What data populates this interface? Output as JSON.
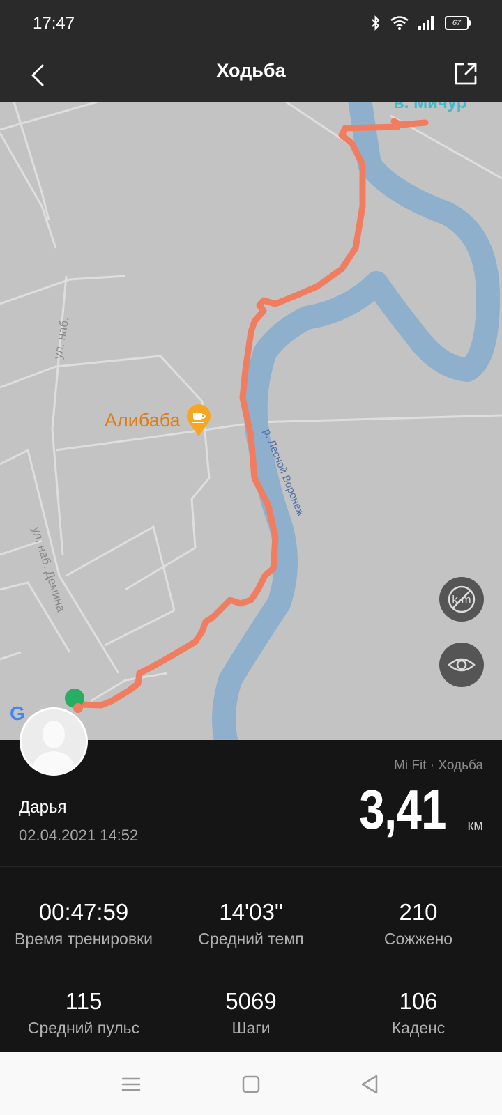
{
  "status_bar": {
    "time": "17:47",
    "battery": "67"
  },
  "app_bar": {
    "title": "Ходьба"
  },
  "map": {
    "poi_label": "Алибаба",
    "street_1": "ул. наб.",
    "street_2": "ул. наб. Демина",
    "river": "р. Лесной Воронеж",
    "top_label": "в. Мичур",
    "google": "Google",
    "route_color": "#f07d60",
    "river_color": "#8fb0cc"
  },
  "profile": {
    "name": "Дарья",
    "date": "02.04.2021 14:52",
    "source": "Mi Fit · Ходьба",
    "distance": "3,41",
    "unit": "км"
  },
  "stats": [
    {
      "value": "00:47:59",
      "label": "Время тренировки"
    },
    {
      "value": "14'03\"",
      "label": "Средний темп"
    },
    {
      "value": "210",
      "label": "Сожжено"
    },
    {
      "value": "115",
      "label": "Средний пульс"
    },
    {
      "value": "5069",
      "label": "Шаги"
    },
    {
      "value": "106",
      "label": "Каденс"
    }
  ]
}
